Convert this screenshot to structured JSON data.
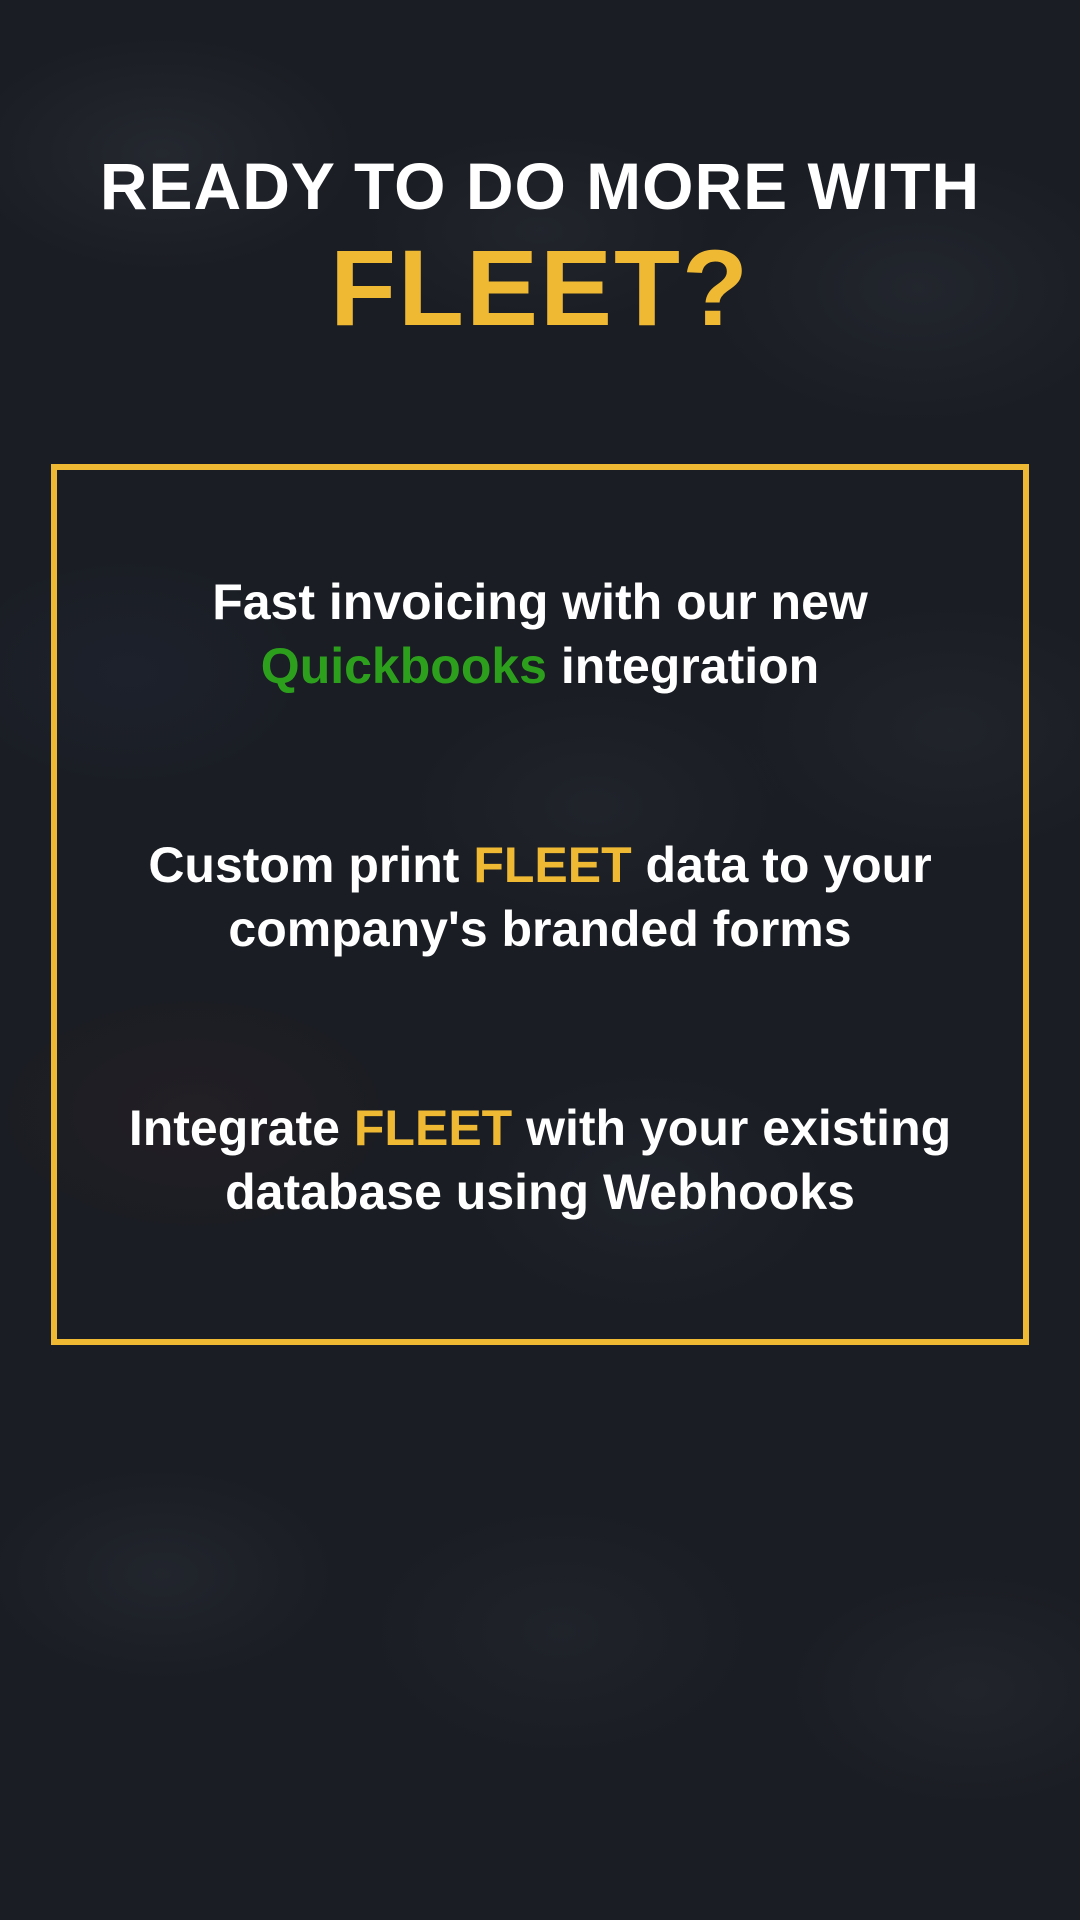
{
  "headline": {
    "top": "READY TO DO MORE WITH",
    "bottom": "FLEET?"
  },
  "features": {
    "item1": {
      "pre": "Fast invoicing with our new ",
      "highlight": "Quickbooks",
      "post": " integration"
    },
    "item2": {
      "pre": "Custom print ",
      "highlight": "FLEET",
      "post": " data to your company's branded forms"
    },
    "item3": {
      "pre": "Integrate ",
      "highlight": "FLEET",
      "post": " with your existing database using Webhooks"
    }
  },
  "colors": {
    "background": "#1a1d23",
    "accent_yellow": "#f0b934",
    "accent_green": "#2ca01c",
    "text": "#ffffff"
  }
}
